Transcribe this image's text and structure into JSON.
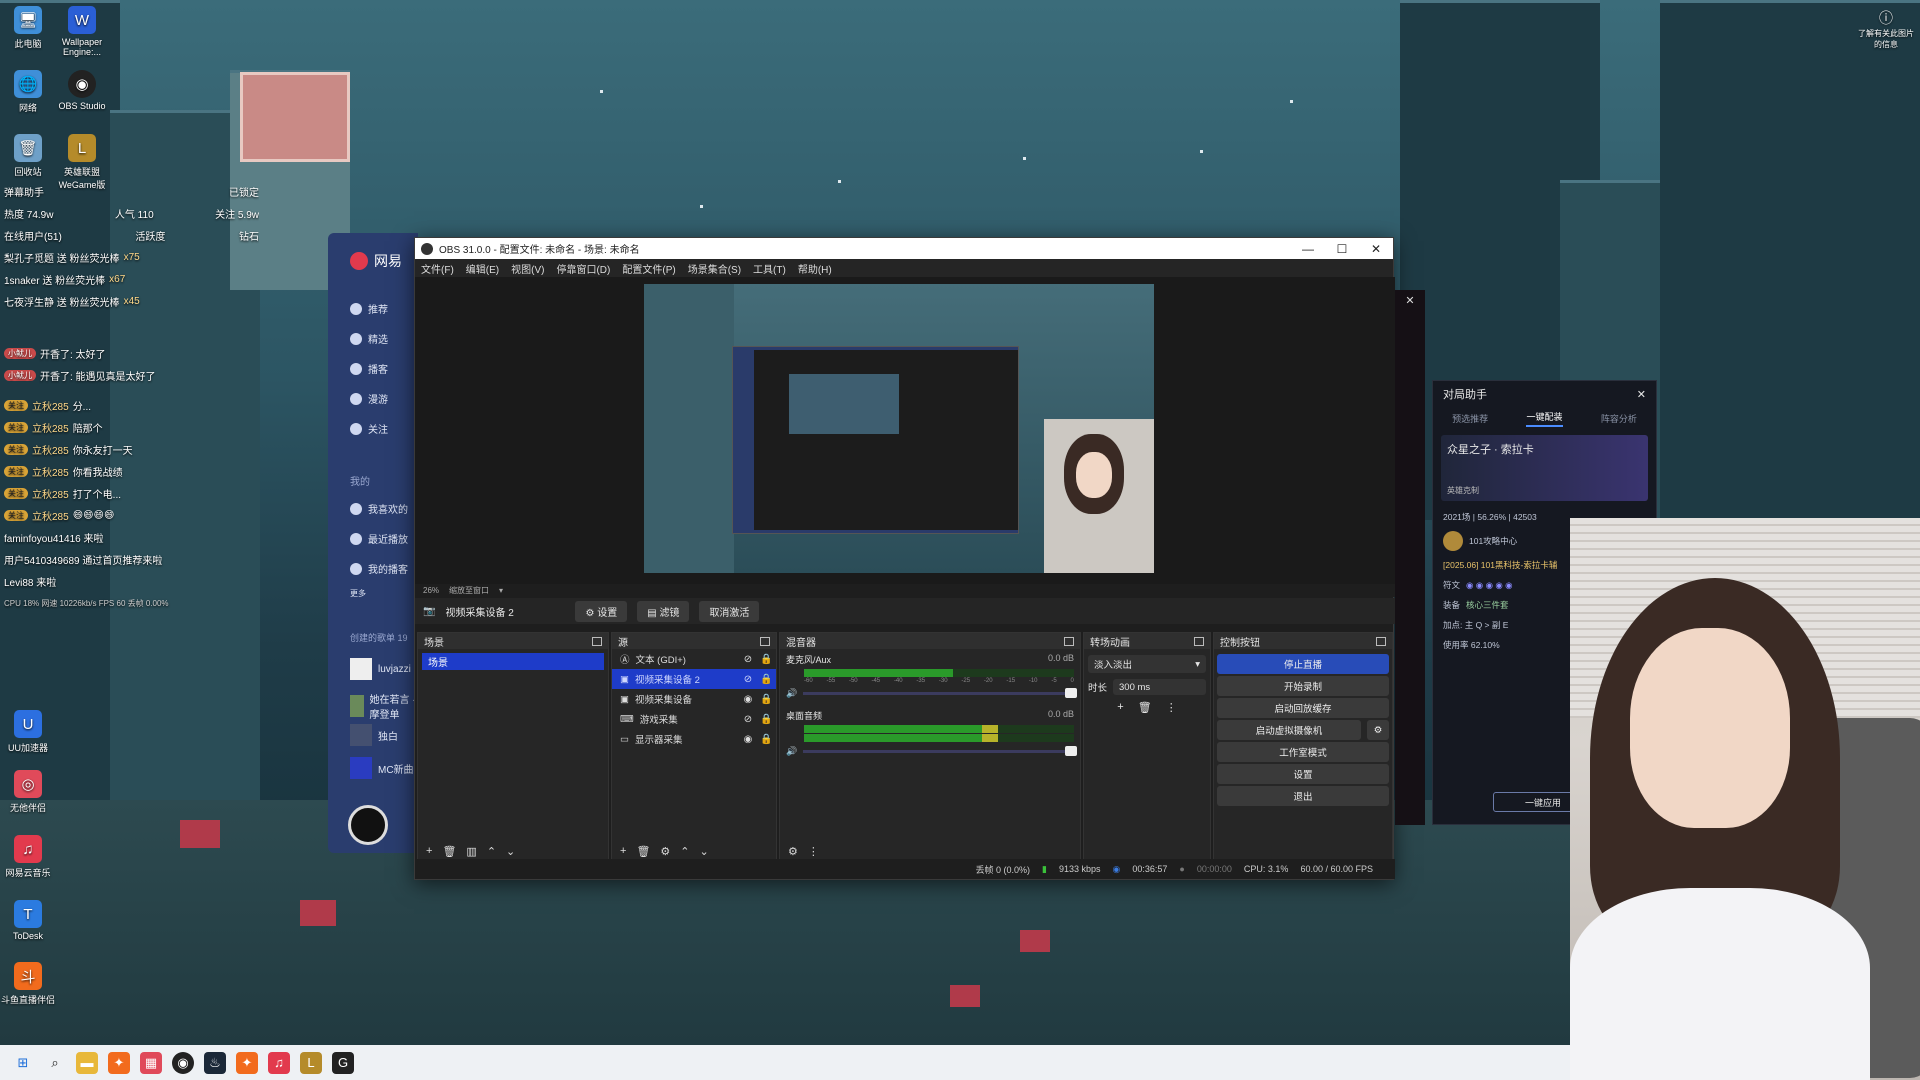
{
  "desktop": {
    "icons": [
      {
        "label": "此电脑"
      },
      {
        "label": "Wallpaper Engine:..."
      },
      {
        "label": "网络"
      },
      {
        "label": "OBS Studio"
      },
      {
        "label": "回收站"
      },
      {
        "label": "英雄联盟 WeGame版"
      },
      {
        "label": "UU加速器"
      },
      {
        "label": "无他伴侣"
      },
      {
        "label": "网易云音乐"
      },
      {
        "label": "ToDesk"
      },
      {
        "label": "斗鱼直播伴侣"
      }
    ],
    "top_right_notice": "了解有关此图片的信息"
  },
  "stream_overlay": {
    "title": "弹幕助手",
    "locked": "已锁定",
    "heat_label": "热度 74.9w",
    "popularity": "人气 110",
    "follow": "关注 5.9w",
    "online_users": "在线用户(51)",
    "active": "活跃度",
    "diamond": "钻石",
    "gift_rows": [
      {
        "text": "梨孔子觅题 送 粉丝荧光棒",
        "count": "x75"
      },
      {
        "text": "1snaker 送 粉丝荧光棒",
        "count": "x67"
      },
      {
        "text": "七夜浮生静 送 粉丝荧光棒",
        "count": "x45"
      }
    ],
    "chat_rows": [
      {
        "name": "小鱿儿",
        "msg": "开香了: 太好了"
      },
      {
        "name": "小鱿儿",
        "msg": "开香了: 能遇见真是太好了"
      },
      {
        "name": "立秋285",
        "msg": "分..."
      },
      {
        "name": "立秋285",
        "msg": "陪那个"
      },
      {
        "name": "立秋285",
        "msg": "你永友打一天"
      },
      {
        "name": "立秋285",
        "msg": "你看我战绩"
      },
      {
        "name": "立秋285",
        "msg": "打了个电..."
      },
      {
        "name": "立秋285",
        "msg": "😄😄😄😄"
      }
    ],
    "enter_rows": [
      {
        "text": "faminfoyou41416 来啦"
      },
      {
        "text": "用户5410349689 通过首页推荐来啦"
      },
      {
        "text": "Levi88 来啦"
      }
    ],
    "stats": "CPU 18%   网速 10226kb/s  FPS 60   丢帧 0.00%"
  },
  "music_app": {
    "brand": "网易",
    "nav": [
      "推荐",
      "精选",
      "播客",
      "漫游",
      "关注"
    ],
    "section": "我的",
    "my_items": [
      "我喜欢的",
      "最近播放",
      "我的播客",
      "更多"
    ],
    "playlist_header": "创建的歌单 19",
    "playlists": [
      "luvjazzi",
      "她在若言 · 摩登单",
      "独白",
      "MC新曲"
    ]
  },
  "obs": {
    "title": "OBS 31.0.0 - 配置文件: 未命名 - 场景: 未命名",
    "menus": [
      "文件(F)",
      "编辑(E)",
      "视图(V)",
      "停靠窗口(D)",
      "配置文件(P)",
      "场景集合(S)",
      "工具(T)",
      "帮助(H)"
    ],
    "zoom": "26%",
    "preview_label": "缩放至窗口",
    "source_toolbar": {
      "source_name": "视频采集设备 2",
      "settings": "设置",
      "filters": "滤镜",
      "deactivate": "取消激活"
    },
    "scenes": {
      "title": "场景",
      "items": [
        "场景"
      ]
    },
    "sources": {
      "title": "源",
      "items": [
        {
          "name": "文本 (GDI+)",
          "icon": "text-icon"
        },
        {
          "name": "视频采集设备 2",
          "icon": "camera-icon"
        },
        {
          "name": "视频采集设备",
          "icon": "camera-icon"
        },
        {
          "name": "游戏采集",
          "icon": "gamepad-icon"
        },
        {
          "name": "显示器采集",
          "icon": "monitor-icon"
        }
      ]
    },
    "mixer": {
      "title": "混音器",
      "tracks": [
        {
          "name": "麦克风/Aux",
          "db": "0.0 dB",
          "level": 0.55
        },
        {
          "name": "桌面音频",
          "db": "0.0 dB",
          "level": 0.72
        }
      ],
      "scale": [
        "-60",
        "-55",
        "-50",
        "-45",
        "-40",
        "-35",
        "-30",
        "-25",
        "-20",
        "-15",
        "-10",
        "-5",
        "0"
      ]
    },
    "transitions": {
      "title": "转场动画",
      "type": "淡入淡出",
      "duration_label": "时长",
      "duration": "300 ms"
    },
    "controls": {
      "title": "控制按钮",
      "buttons": [
        "停止直播",
        "开始录制",
        "启动回放缓存",
        "启动虚拟摄像机",
        "工作室模式",
        "设置",
        "退出"
      ]
    },
    "status": {
      "dropped": "丢帧 0 (0.0%)",
      "bitrate": "9133 kbps",
      "live_time": "00:36:57",
      "rec_time": "00:00:00",
      "cpu": "CPU: 3.1%",
      "fps": "60.00 / 60.00 FPS"
    }
  },
  "assist_panel": {
    "title": "对局助手",
    "tabs": [
      "预选推荐",
      "一键配装",
      "阵容分析"
    ],
    "champion": "众星之子 · 索拉卡",
    "counter": "英雄克制",
    "stats": "2021场 | 56.26% | 42503",
    "guide": "101攻略中心",
    "version": "[2025.06] 101黑科技-索拉卡辅",
    "rune_label": "符文",
    "item_label": "装备",
    "core": "核心三件套",
    "skill": "加点: 主 Q > 副 E",
    "usage": "使用率 62.10%",
    "apply": "一键应用"
  }
}
